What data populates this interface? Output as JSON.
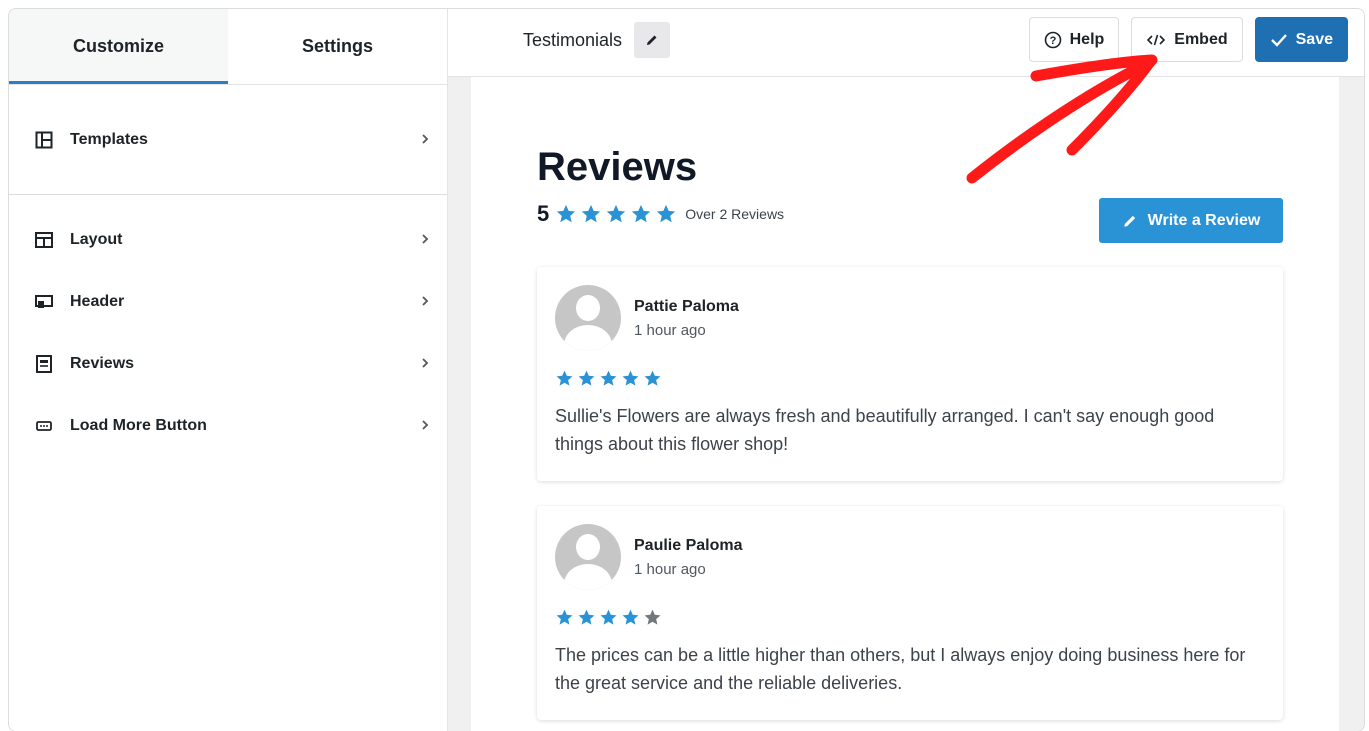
{
  "sidebar": {
    "tabs": [
      {
        "label": "Customize",
        "active": true
      },
      {
        "label": "Settings",
        "active": false
      }
    ],
    "items": [
      {
        "label": "Templates",
        "icon": "templates-icon"
      },
      {
        "label": "Layout",
        "icon": "layout-icon"
      },
      {
        "label": "Header",
        "icon": "header-icon"
      },
      {
        "label": "Reviews",
        "icon": "reviews-icon"
      },
      {
        "label": "Load More Button",
        "icon": "load-more-icon"
      }
    ]
  },
  "topbar": {
    "title": "Testimonials",
    "help_label": "Help",
    "embed_label": "Embed",
    "save_label": "Save"
  },
  "preview": {
    "heading": "Reviews",
    "rating": "5",
    "rating_stars": 5,
    "review_count_text": "Over 2 Reviews",
    "write_review_label": "Write a Review",
    "reviews": [
      {
        "name": "Pattie Paloma",
        "time": "1 hour ago",
        "stars": 5,
        "text": "Sullie's Flowers are always fresh and beautifully arranged. I can't say enough good things about this flower shop!"
      },
      {
        "name": "Paulie Paloma",
        "time": "1 hour ago",
        "stars": 4,
        "text": "The prices can be a little higher than others, but I always enjoy doing business here for the great service and the reliable deliveries."
      }
    ]
  },
  "colors": {
    "accent": "#1f6fb3",
    "star": "#2a93d5",
    "star_empty": "#72777c",
    "annotation": "#ff1a1a"
  }
}
